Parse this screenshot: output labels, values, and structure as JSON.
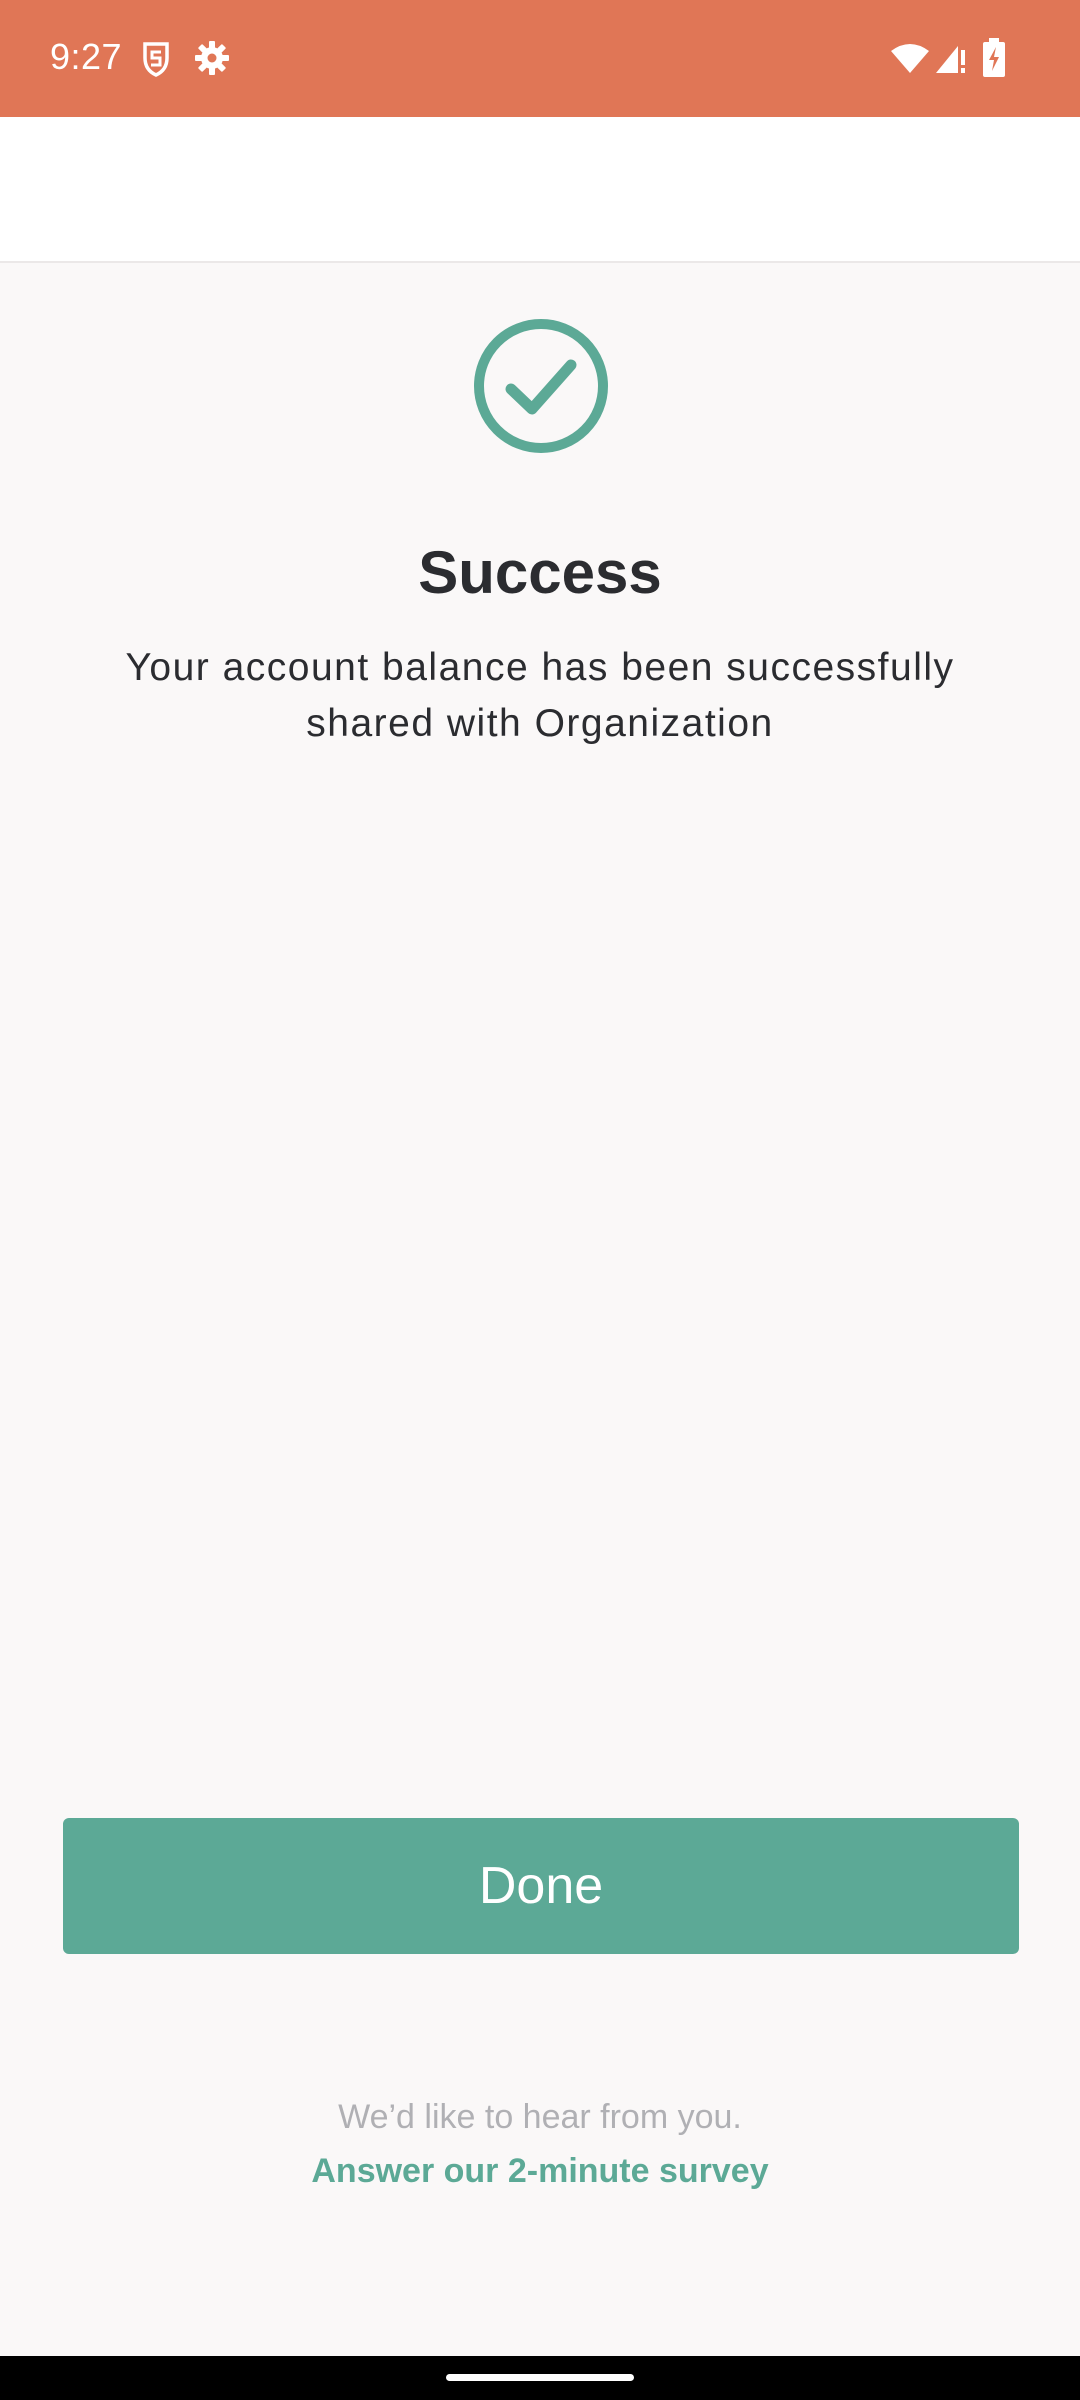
{
  "status_bar": {
    "time": "9:27",
    "background": "#e07656",
    "left_icons": [
      "shield-s-icon",
      "gear-icon"
    ],
    "right_icons": [
      "wifi-icon",
      "cell-signal-icon",
      "battery-charging-icon"
    ]
  },
  "main": {
    "icon": "check-circle-icon",
    "title": "Success",
    "message": "Your account balance has been successfully shared with Organization",
    "done_label": "Done",
    "accent": "#5ca996"
  },
  "survey": {
    "prompt": "We’d like to hear from you.",
    "link": "Answer our 2-minute survey"
  }
}
